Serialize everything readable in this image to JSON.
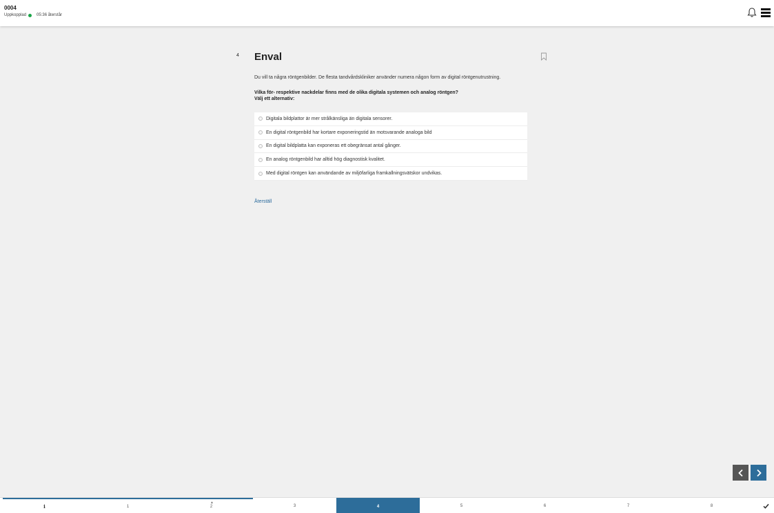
{
  "header": {
    "exam_id": "0004",
    "connection_status": "Uppkopplad",
    "time_left": "05:36 återstår"
  },
  "question": {
    "number": "4",
    "type_title": "Enval",
    "intro": "Du vill ta några röntgenbilder. De flesta tandvårdskliniker använder numera någon form av digital röntgenutrustning.",
    "prompt": "Vilka för- respektive nackdelar finns med de olika digitala systemen och analog röntgen?",
    "instruction": "Välj ett alternativ:",
    "options": [
      "Digitala bildplattor är mer strålkänsliga än digitala sensorer.",
      "En digital röntgenbild har kortare exponeringstid än motsvarande analoga bild",
      "En digital bildplatta kan exponeras ett obegränsat antal gånger.",
      "En analog röntgenbild har alltid hög diagnostisk kvalitet.",
      "Med digital röntgen kan användande av miljöfarliga framkallningsvätskor undvikas."
    ],
    "reset_label": "Återställ"
  },
  "bottom_nav": {
    "info_label": "i",
    "tabs": [
      "1",
      "2",
      "3",
      "4",
      "5",
      "6",
      "7",
      "8"
    ],
    "active_tab": "4",
    "finish_icon": "checkmark-icon"
  },
  "colors": {
    "accent": "#2d6d9a",
    "online": "#1aa548",
    "background": "#f0f0f0"
  }
}
